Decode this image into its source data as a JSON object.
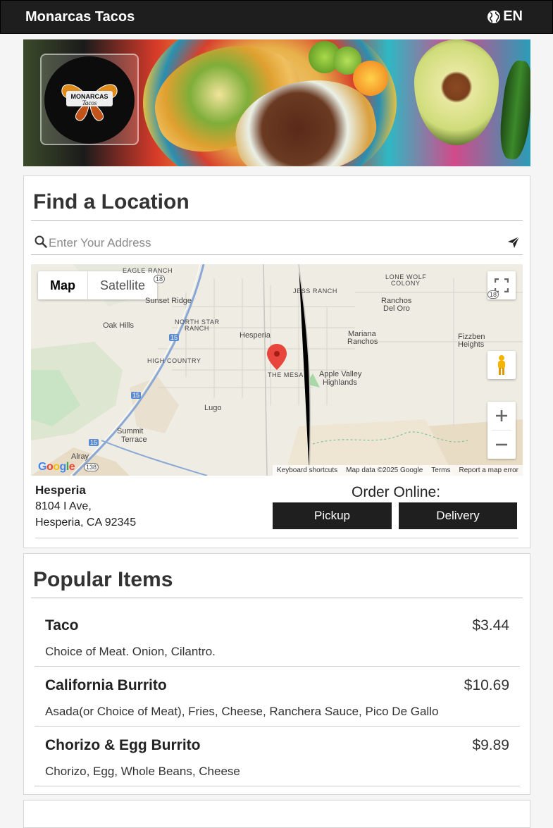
{
  "header": {
    "brand": "Monarcas Tacos",
    "language": "EN"
  },
  "hero": {
    "logo_text": "MONARCAS Tacos"
  },
  "find_location": {
    "title": "Find a Location",
    "search_placeholder": "Enter Your Address",
    "map": {
      "toggle": [
        "Map",
        "Satellite"
      ],
      "labels": {
        "eagle_ranch": "EAGLE RANCH",
        "lone_wolf": "LONE WOLF",
        "colony": "COLONY",
        "sunset_ridge": "Sunset Ridge",
        "jess_ranch": "JESS RANCH",
        "ranchos": "Ranchos",
        "del_oro": "Del Oro",
        "oak_hills": "Oak Hills",
        "north_star": "NORTH STAR",
        "ranch": "RANCH",
        "hesperia": "Hesperia",
        "mariana": "Mariana",
        "ranchos2": "Ranchos",
        "fizzben": "Fizzben",
        "heights": "Heights",
        "high_country": "HIGH COUNTRY",
        "the_mesa": "THE MESA",
        "apple_valley": "Apple Valley",
        "highlands": "Highlands",
        "lugo": "Lugo",
        "summit": "Summit",
        "terrace": "Terrace",
        "alray": "Alray",
        "hw15a": "15",
        "hw15b": "15",
        "hw15c": "15",
        "hw138": "138",
        "hw18": "18"
      },
      "footer": [
        "Keyboard shortcuts",
        "Map data ©2025 Google",
        "Terms",
        "Report a map error"
      ],
      "google": "Google"
    },
    "location": {
      "name": "Hesperia",
      "address1": "8104 I Ave,",
      "address2": "Hesperia, CA 92345"
    },
    "order": {
      "label": "Order Online:",
      "pickup": "Pickup",
      "delivery": "Delivery"
    }
  },
  "popular": {
    "title": "Popular Items",
    "items": [
      {
        "name": "Taco",
        "price": "$3.44",
        "desc": "Choice of Meat. Onion, Cilantro."
      },
      {
        "name": "California Burrito",
        "price": "$10.69",
        "desc": "Asada(or Choice of Meat), Fries, Cheese, Ranchera Sauce, Pico De Gallo"
      },
      {
        "name": "Chorizo & Egg Burrito",
        "price": "$9.89",
        "desc": "Chorizo, Egg, Whole Beans, Cheese"
      }
    ]
  }
}
